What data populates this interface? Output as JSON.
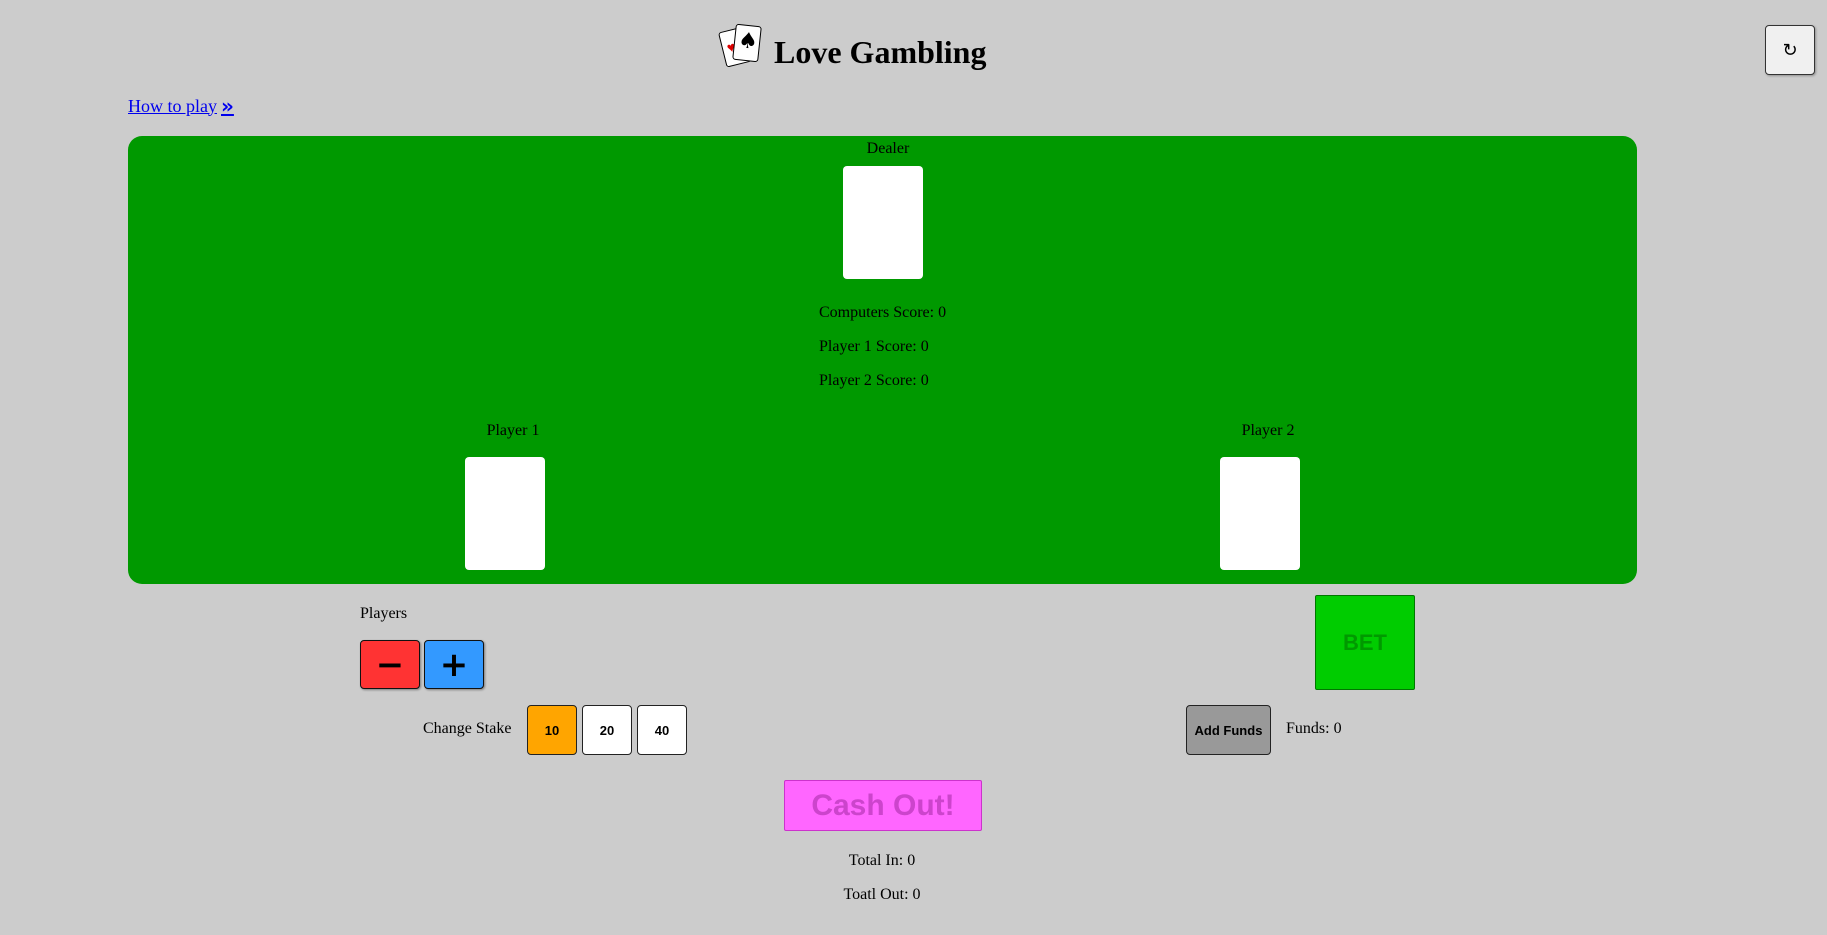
{
  "header": {
    "title": "Love Gambling",
    "logo_icon": "playing-cards-icon"
  },
  "refresh": {
    "icon": "refresh-icon",
    "glyph": "↻"
  },
  "howto": {
    "label": "How to play ",
    "chevron": "»"
  },
  "table": {
    "color": "#009900",
    "dealer_label": "Dealer",
    "player1_label": "Player 1",
    "player2_label": "Player 2",
    "scores": [
      "Computers Score: 0",
      "Player 1 Score: 0",
      "Player 2 Score: 0"
    ]
  },
  "controls": {
    "players_label": "Players",
    "minus_glyph": "−",
    "plus_glyph": "+",
    "stake_label": "Change Stake",
    "stakes": [
      "10",
      "20",
      "40"
    ],
    "selected_stake": "10",
    "bet_label": "BET",
    "add_funds_label": "Add Funds",
    "funds_text": "Funds: 0",
    "cashout_label": "Cash Out!",
    "total_in": "Total In: 0",
    "total_out": "Toatl Out: 0"
  },
  "colors": {
    "background": "#cccccc",
    "minus": "#ff3333",
    "plus": "#3399ff",
    "stake_active": "#ffa500",
    "bet": "#00cc00",
    "add_funds": "#999999",
    "cashout": "#ff66ff"
  }
}
